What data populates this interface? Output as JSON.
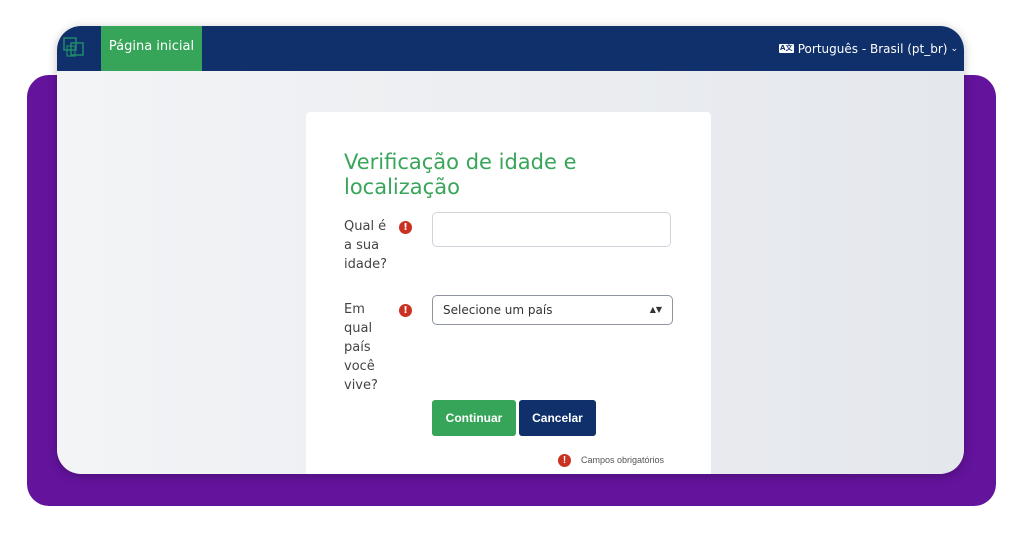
{
  "navbar": {
    "home_label": "Página inicial",
    "language_label": "Português - Brasil (pt_br)",
    "language_icon": "language-icon",
    "language_chevron": "⌄"
  },
  "form": {
    "title": "Verificação de idade e localização",
    "age_label": "Qual é a sua idade?",
    "age_value": "",
    "country_label": "Em qual país você vive?",
    "country_selected": "Selecione um país",
    "continue_label": "Continuar",
    "cancel_label": "Cancelar",
    "required_note": "Campos obrigatórios",
    "required_icon": "!"
  },
  "colors": {
    "navbar_bg": "#10306b",
    "accent_green": "#36a559",
    "purple_frame": "#64139c",
    "required_red": "#ca3120"
  }
}
